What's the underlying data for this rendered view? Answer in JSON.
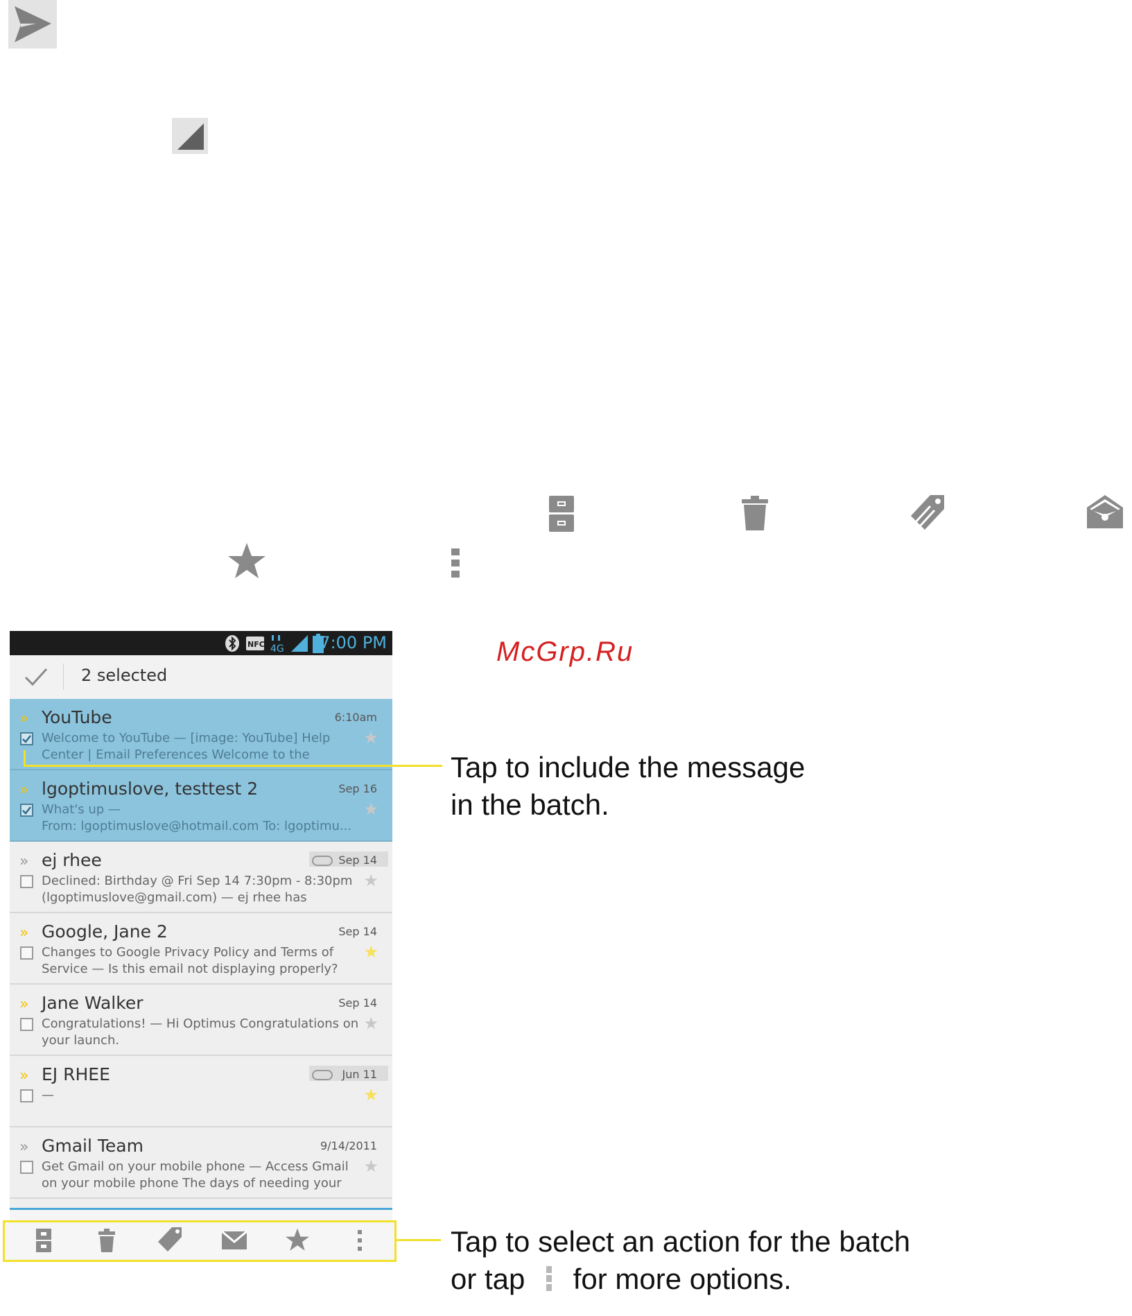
{
  "icons": {
    "send": "send-icon",
    "corner": "corner-triangle-icon",
    "archive": "archive-icon",
    "delete": "trash-icon",
    "label": "label-tag-icon",
    "mark_unread": "envelope-open-icon",
    "star": "star-icon",
    "menu": "overflow-menu-icon"
  },
  "phone": {
    "status_time": "7:00 PM",
    "status_icons": [
      "bluetooth-icon",
      "nfc-icon",
      "4g-icon",
      "signal-icon",
      "battery-icon"
    ],
    "selected_label": "2 selected",
    "messages": [
      {
        "sender": "YouTube",
        "date": "6:10am",
        "line1": "Welcome to YouTube — [image: YouTube] Help",
        "line2": "Center | Email Preferences Welcome to the",
        "selected": true,
        "unread": true,
        "starred": false,
        "attachment": false
      },
      {
        "sender": "lgoptimuslove, testtest  2",
        "date": "Sep 16",
        "line1": "What's up —",
        "line2": "From: lgoptimuslove@hotmail.com To: lgoptimu...",
        "selected": true,
        "unread": true,
        "starred": false,
        "attachment": false
      },
      {
        "sender": "ej rhee",
        "date": "Sep 14",
        "line1": "Declined: Birthday @ Fri Sep 14 7:30pm - 8:30pm",
        "line2": "(lgoptimuslove@gmail.com) — ej rhee has",
        "selected": false,
        "unread": false,
        "starred": false,
        "attachment": true
      },
      {
        "sender": "Google, Jane  2",
        "date": "Sep 14",
        "line1": "Changes to Google Privacy Policy and Terms of",
        "line2": "Service — Is this email not displaying properly?",
        "selected": false,
        "unread": true,
        "starred": true,
        "attachment": false
      },
      {
        "sender": "Jane Walker",
        "date": "Sep 14",
        "line1": "Congratulations! — Hi Optimus Congratulations on",
        "line2": "your launch.",
        "selected": false,
        "unread": true,
        "starred": false,
        "attachment": false
      },
      {
        "sender": "EJ RHEE",
        "date": "Jun 11",
        "line1": "—",
        "line2": "",
        "selected": false,
        "unread": true,
        "starred": true,
        "attachment": true
      },
      {
        "sender": "Gmail Team",
        "date": "9/14/2011",
        "line1": "Get Gmail on your mobile phone — Access Gmail",
        "line2": "on your mobile phone The days of needing your",
        "selected": false,
        "unread": false,
        "starred": false,
        "attachment": false
      }
    ]
  },
  "callouts": {
    "include": {
      "line1": "Tap to include the message",
      "line2": "in the batch."
    },
    "action": {
      "line1": "Tap to select an action for the batch",
      "line2_pre": "or tap",
      "line2_post": "for more options."
    }
  },
  "watermark": "McGrp.Ru"
}
